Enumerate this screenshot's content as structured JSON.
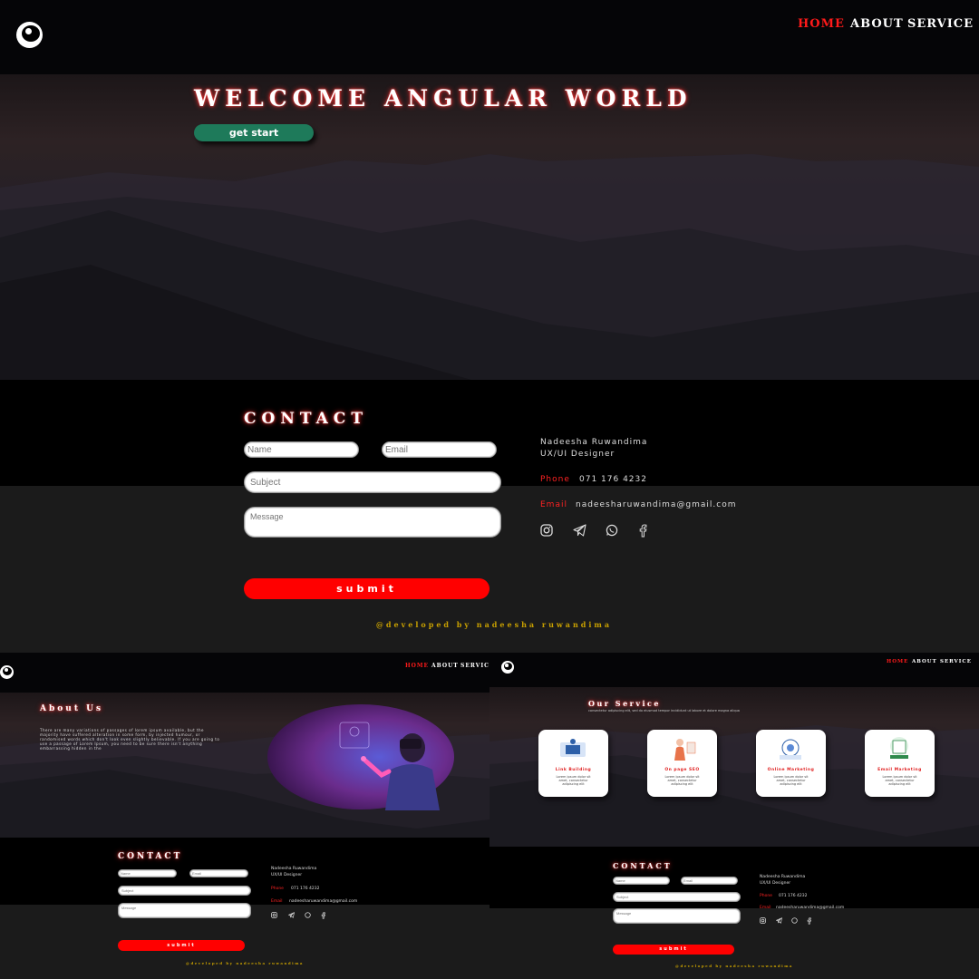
{
  "nav": {
    "home": "HOME",
    "about": "ABOUT",
    "service": "SERVICE"
  },
  "hero": {
    "title": "WELCOME ANGULAR WORLD",
    "cta": "get start"
  },
  "contact": {
    "heading": "CONTACT",
    "placeholders": {
      "name": "Name",
      "email": "Email",
      "subject": "Subject",
      "message": "Message"
    },
    "submit": "submit",
    "person_name": "Nadeesha Ruwandima",
    "role": "UX/UI Designer",
    "phone_label": "Phone",
    "phone": "071 176 4232",
    "email_label": "Email",
    "email": "nadeesharuwandima@gmail.com",
    "socials": [
      "instagram-icon",
      "telegram-icon",
      "whatsapp-icon",
      "facebook-icon"
    ]
  },
  "credit": "@developed by nadeesha ruwandima",
  "about": {
    "heading": "About Us",
    "paragraph": "There are many variations of passages of lorem ipsum available, but the majority have suffered alteration in some form, by injected humour, or randomised words which don't look even slightly believable. If you are going to use a passage of Lorem Ipsum, you need to be sure there isn't anything embarrassing hidden in the"
  },
  "service": {
    "heading": "Our Service",
    "subtitle": "consectetur adipiscing elit, sed do eiusmod tempor incididunt ut labore et dolore magna aliqua",
    "cards": [
      {
        "title": "Link Building",
        "text": "Lorem ipsum dolor sit amet, consectetur adipiscing elit"
      },
      {
        "title": "On page SEO",
        "text": "Lorem ipsum dolor sit amet, consectetur adipiscing elit"
      },
      {
        "title": "Online Marketing",
        "text": "Lorem ipsum dolor sit amet, consectetur adipiscing elit"
      },
      {
        "title": "Email Marketing",
        "text": "Lorem ipsum dolor sit amet, consectetur adipiscing elit"
      }
    ]
  },
  "colors": {
    "accent_red": "#ff0000",
    "nav_active": "#ff1a1a",
    "cta_green": "#1e7a5a",
    "credit_gold": "#c8a000"
  }
}
